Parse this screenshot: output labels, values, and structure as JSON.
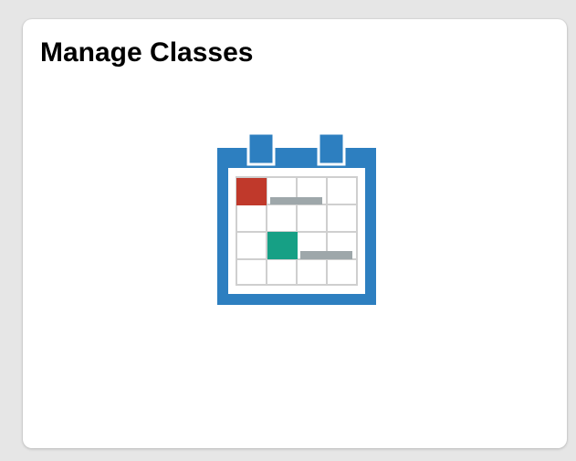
{
  "tile": {
    "title": "Manage Classes",
    "icon": "calendar-icon"
  },
  "colors": {
    "calendar_frame": "#2d7fc0",
    "event_red": "#c0392b",
    "event_green": "#16a085",
    "event_bar_gray": "#9ea7aa",
    "grid_line": "#cfcfcf"
  }
}
